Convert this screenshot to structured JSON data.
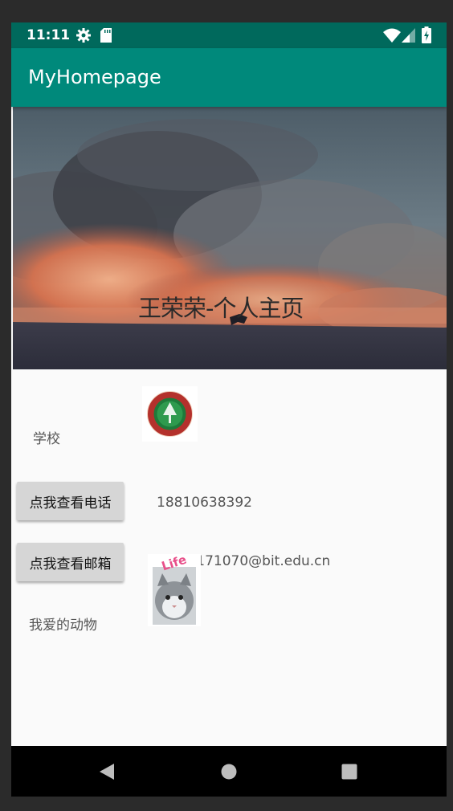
{
  "status_bar": {
    "time": "11:11",
    "icons": [
      "gear-icon",
      "sd-card-icon",
      "wifi-icon",
      "signal-icon",
      "battery-charging-icon"
    ]
  },
  "app_bar": {
    "title": "MyHomepage",
    "color": "#00897b"
  },
  "hero": {
    "title": "王荣荣-个人主页"
  },
  "profile": {
    "school_label": "学校",
    "phone_button": "点我查看电话",
    "phone_value": "18810638392",
    "email_button": "点我查看邮箱",
    "email_value": "2120171070@bit.edu.cn",
    "pet_label": "我爱的动物",
    "pet_image_text": "Life"
  },
  "nav_bar": {
    "icons": [
      "back-icon",
      "home-icon",
      "recents-icon"
    ]
  }
}
